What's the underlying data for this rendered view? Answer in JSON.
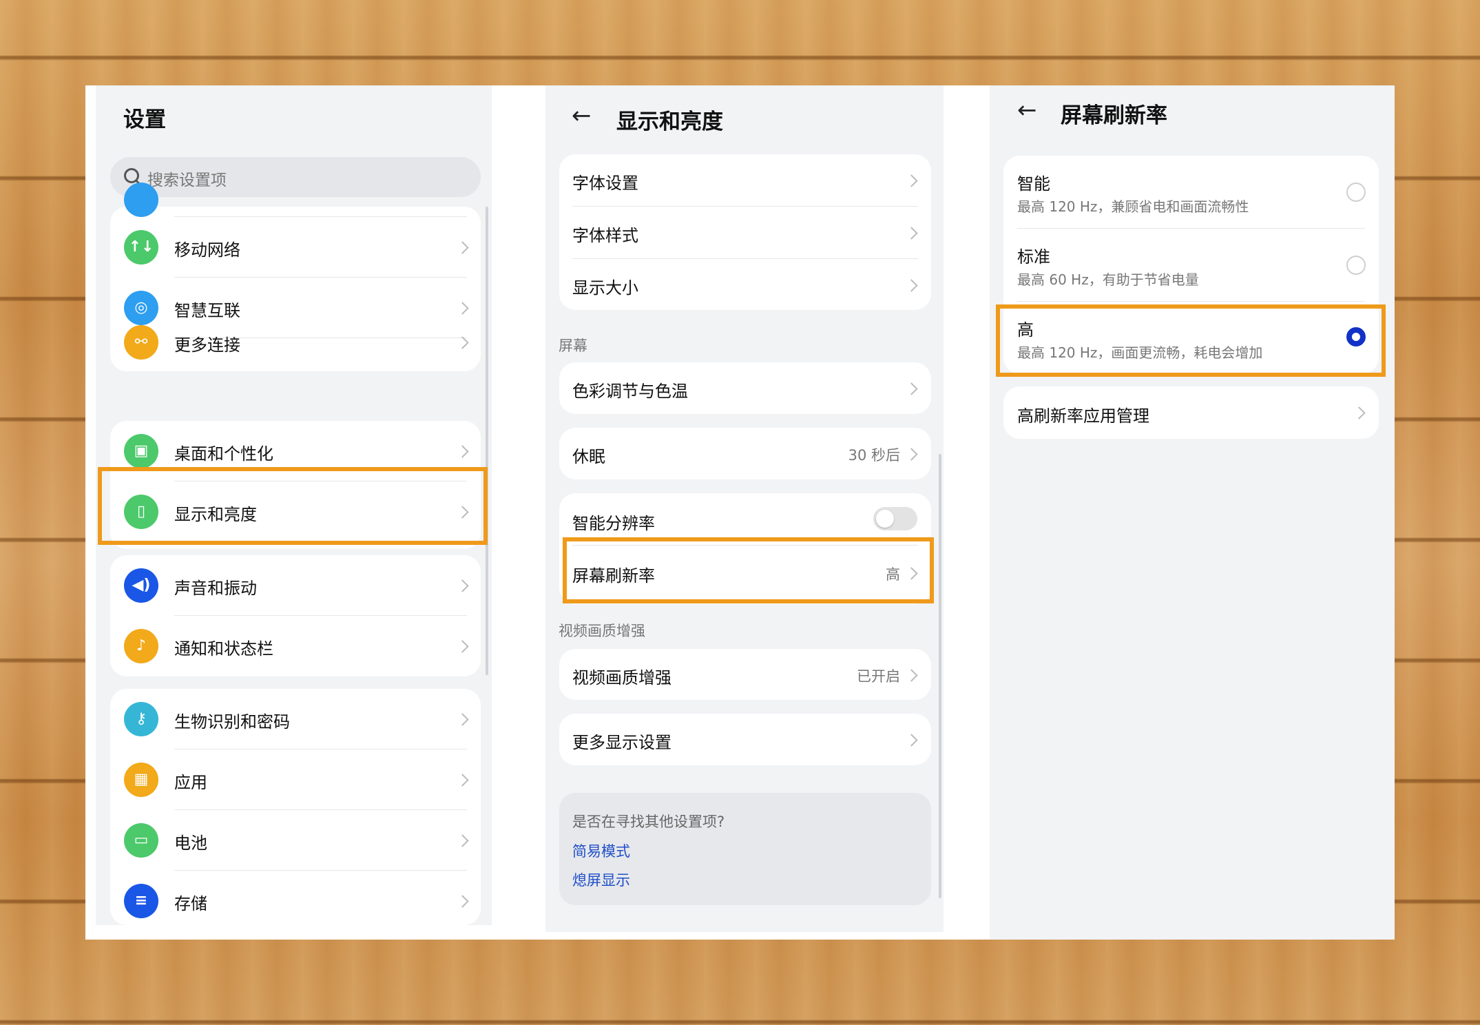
{
  "panel1": {
    "title": "设置",
    "search_placeholder": "搜索设置项",
    "items": [
      {
        "label": "移动网络",
        "icon": "↑↓",
        "color": "#4cc96a"
      },
      {
        "label": "智慧互联",
        "icon": "◎",
        "color": "#2e9ef0"
      },
      {
        "label": "更多连接",
        "icon": "⚯",
        "color": "#f2a91a"
      },
      {
        "label": "桌面和个性化",
        "icon": "▣",
        "color": "#4cc96a"
      },
      {
        "label": "显示和亮度",
        "icon": "▯",
        "color": "#4cc96a"
      },
      {
        "label": "声音和振动",
        "icon": "◀)",
        "color": "#1a57e6"
      },
      {
        "label": "通知和状态栏",
        "icon": "♪",
        "color": "#f2a91a"
      },
      {
        "label": "生物识别和密码",
        "icon": "⚷",
        "color": "#36b6d6"
      },
      {
        "label": "应用",
        "icon": "▦",
        "color": "#f2a91a"
      },
      {
        "label": "电池",
        "icon": "▭",
        "color": "#4cc96a"
      },
      {
        "label": "存储",
        "icon": "≡",
        "color": "#1a57e6"
      }
    ]
  },
  "panel2": {
    "back_glyph": "←",
    "title": "显示和亮度",
    "font_settings": "字体设置",
    "font_style": "字体样式",
    "display_size": "显示大小",
    "section_screen": "屏幕",
    "color_temp": "色彩调节与色温",
    "sleep": "休眠",
    "sleep_value": "30 秒后",
    "smart_resolution": "智能分辨率",
    "smart_resolution_on": false,
    "refresh_rate": "屏幕刷新率",
    "refresh_rate_value": "高",
    "section_video": "视频画质增强",
    "video_enhance": "视频画质增强",
    "video_enhance_value": "已开启",
    "more_display": "更多显示设置",
    "suggest_title": "是否在寻找其他设置项?",
    "suggest_link1": "简易模式",
    "suggest_link2": "熄屏显示"
  },
  "panel3": {
    "back_glyph": "←",
    "title": "屏幕刷新率",
    "options": [
      {
        "label": "智能",
        "desc": "最高 120 Hz，兼顾省电和画面流畅性",
        "selected": false
      },
      {
        "label": "标准",
        "desc": "最高 60 Hz，有助于节省电量",
        "selected": false
      },
      {
        "label": "高",
        "desc": "最高 120 Hz，画面更流畅，耗电会增加",
        "selected": true
      }
    ],
    "app_manage": "高刷新率应用管理"
  },
  "colors": {
    "highlight": "#ef9a1a",
    "radio_selected": "#1232c7",
    "link": "#1f4ec8"
  }
}
